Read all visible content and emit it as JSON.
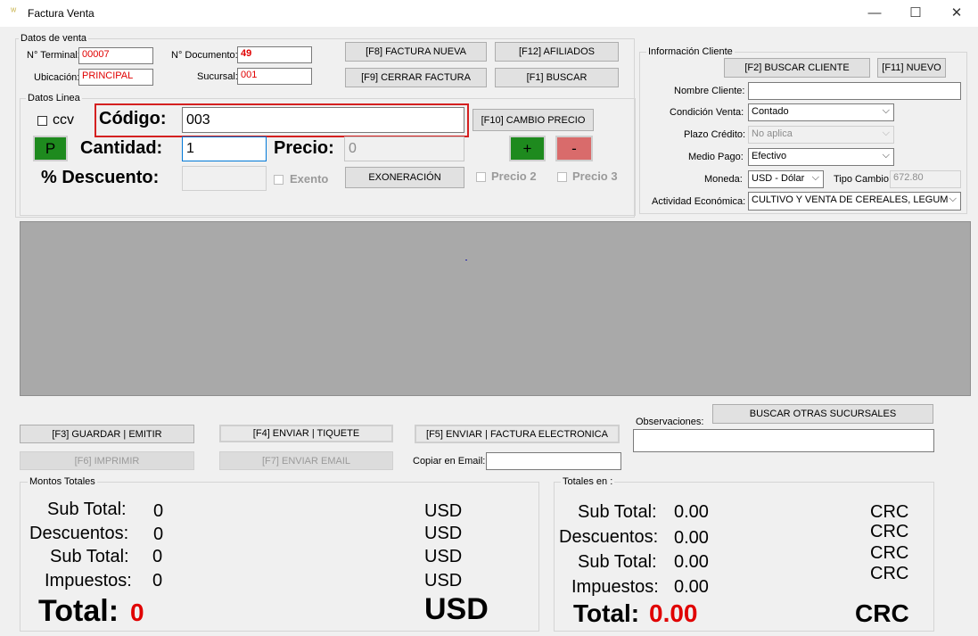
{
  "window": {
    "title": "Factura Venta",
    "min": "—",
    "max": "☐",
    "close": "✕"
  },
  "datos_venta": {
    "title": "Datos de venta",
    "terminal_label": "N° Terminal:",
    "terminal": "00007",
    "documento_label": "N° Documento:",
    "documento": "49",
    "ubicacion_label": "Ubicación:",
    "ubicacion": "PRINCIPAL",
    "sucursal_label": "Sucursal:",
    "sucursal": "001"
  },
  "buttons": {
    "factura_nueva": "[F8] FACTURA NUEVA",
    "afiliados": "[F12] AFILIADOS",
    "cerrar_factura": "[F9] CERRAR FACTURA",
    "buscar": "[F1] BUSCAR",
    "cambio_precio": "[F10] CAMBIO PRECIO",
    "p": "P",
    "plus": "+",
    "minus": "-",
    "exoneracion": "EXONERACIÓN",
    "guardar": "[F3] GUARDAR | EMITIR",
    "enviar_tiquete": "[F4] ENVIAR | TIQUETE",
    "enviar_factura": "[F5] ENVIAR | FACTURA ELECTRONICA",
    "imprimir": "[F6] IMPRIMIR",
    "enviar_email": "[F7] ENVIAR EMAIL",
    "buscar_sucursales": "BUSCAR OTRAS SUCURSALES"
  },
  "datos_linea": {
    "title": "Datos Linea",
    "ccv": "ccv",
    "codigo_label": "Código:",
    "codigo": "003",
    "cantidad_label": "Cantidad:",
    "cantidad": "1",
    "precio_label": "Precio:",
    "precio": "0",
    "descuento_label": "% Descuento:",
    "descuento": "",
    "exento": "Exento",
    "precio2": "Precio 2",
    "precio3": "Precio 3"
  },
  "cliente": {
    "title": "Información Cliente",
    "buscar_cliente": "[F2] BUSCAR CLIENTE",
    "nuevo": "[F11] NUEVO",
    "nombre_label": "Nombre Cliente:",
    "nombre": "",
    "condicion_label": "Condición Venta:",
    "condicion": "Contado",
    "plazo_label": "Plazo Crédito:",
    "plazo": "No aplica",
    "medio_label": "Medio Pago:",
    "medio": "Efectivo",
    "moneda_label": "Moneda:",
    "moneda": "USD - Dólar",
    "tipo_cambio_label": "Tipo Cambio:",
    "tipo_cambio": "672.80",
    "actividad_label": "Actividad Económica:",
    "actividad": "CULTIVO Y VENTA DE CEREALES, LEGUM"
  },
  "observaciones": {
    "label": "Observaciones:",
    "value": "",
    "copiar_label": "Copiar en Email:",
    "copiar": ""
  },
  "montos": {
    "title": "Montos Totales",
    "subtotal_label": "Sub Total:",
    "subtotal": "0",
    "descuentos_label": "Descuentos:",
    "descuentos": "0",
    "subtotal2_label": "Sub Total:",
    "subtotal2": "0",
    "impuestos_label": "Impuestos:",
    "impuestos": "0",
    "total_label": "Total:",
    "total": "0",
    "currency": "USD"
  },
  "totales": {
    "title": "Totales en :",
    "subtotal_label": "Sub Total:",
    "subtotal": "0.00",
    "descuentos_label": "Descuentos:",
    "descuentos": "0.00",
    "subtotal2_label": "Sub Total:",
    "subtotal2": "0.00",
    "impuestos_label": "Impuestos:",
    "impuestos": "0.00",
    "total_label": "Total:",
    "total": "0.00",
    "currency": "CRC"
  },
  "colors": {
    "accent_red": "#e00000",
    "green_button": "#1e8a1e",
    "red_button": "#d96b6b",
    "grid_bg": "#a9a9a9",
    "highlight_border": "#d42020"
  }
}
